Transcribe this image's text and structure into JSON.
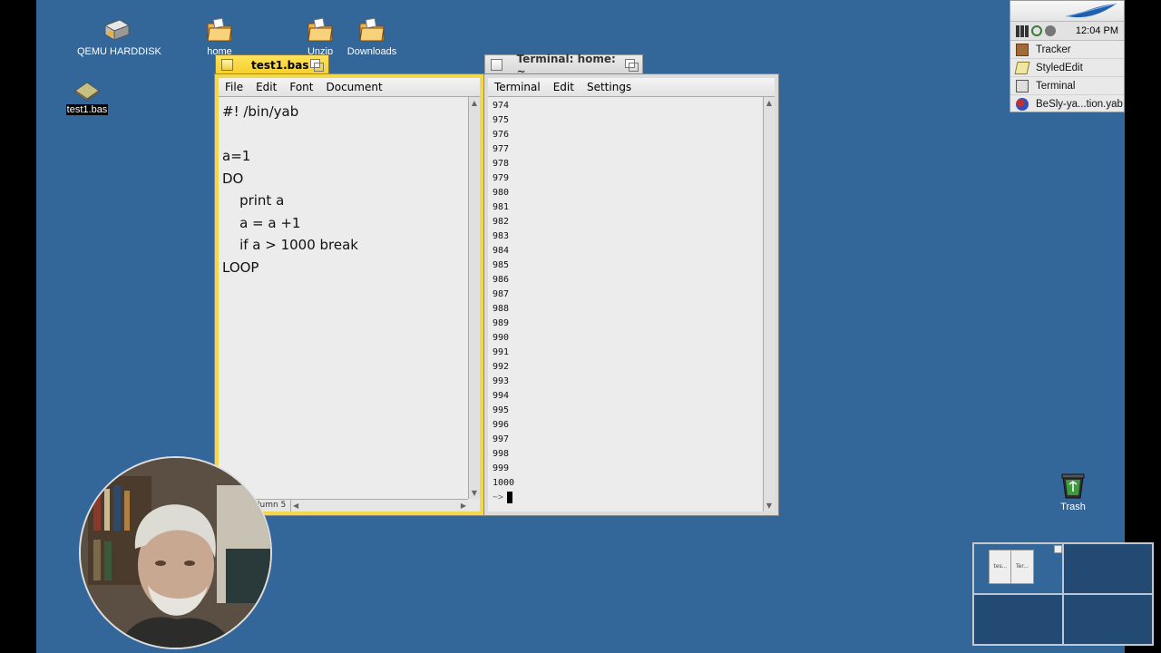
{
  "desktop": {
    "icons": [
      {
        "label": "QEMU HARDDISK"
      },
      {
        "label": "home"
      },
      {
        "label": "Unzip"
      },
      {
        "label": "Downloads"
      },
      {
        "label": "test1.bas"
      },
      {
        "label": "Trash"
      }
    ]
  },
  "editor": {
    "title": "test1.bas",
    "menu": [
      "File",
      "Edit",
      "Font",
      "Document"
    ],
    "lines": [
      "#! /bin/yab",
      "",
      "a=1",
      "DO",
      "    print a",
      "    a = a +1",
      "    if a > 1000 break",
      "LOOP"
    ],
    "status": "line 7, column 5"
  },
  "terminal": {
    "title": "Terminal: home: ~",
    "menu": [
      "Terminal",
      "Edit",
      "Settings"
    ],
    "lines": [
      "974",
      "975",
      "976",
      "977",
      "978",
      "979",
      "980",
      "981",
      "982",
      "983",
      "984",
      "985",
      "986",
      "987",
      "988",
      "989",
      "990",
      "991",
      "992",
      "993",
      "994",
      "995",
      "996",
      "997",
      "998",
      "999",
      "1000"
    ],
    "prompt": "~>"
  },
  "deskbar": {
    "clock": "12:04 PM",
    "apps": [
      "Tracker",
      "StyledEdit",
      "Terminal",
      "BeSly-ya...tion.yab"
    ]
  },
  "workspaces": {
    "thumbs": [
      "tes...",
      "Ter..."
    ]
  },
  "colors": {
    "desktop": "#336699",
    "active_tab": "#f5cf2a",
    "window_bg": "#e8e8e8"
  }
}
